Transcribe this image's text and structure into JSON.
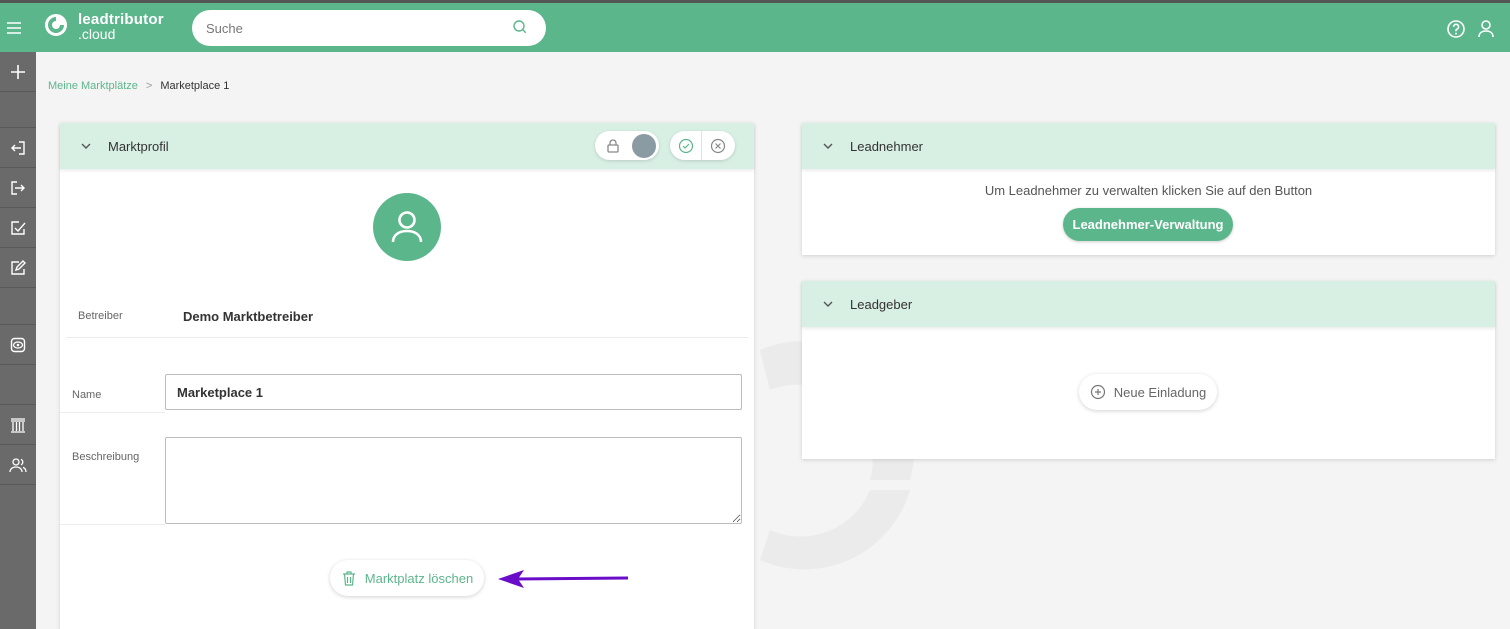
{
  "brand": {
    "name": "leadtributor",
    "suffix": ".cloud"
  },
  "search": {
    "placeholder": "Suche"
  },
  "breadcrumb": {
    "root": "Meine Marktplätze",
    "separator": ">",
    "current": "Marketplace 1"
  },
  "marktprofil": {
    "title": "Marktprofil",
    "betreiber_label": "Betreiber",
    "betreiber_value": "Demo Marktbetreiber",
    "name_label": "Name",
    "name_value": "Marketplace 1",
    "beschreibung_label": "Beschreibung",
    "beschreibung_value": "",
    "delete_label": "Marktplatz löschen"
  },
  "leadnehmer": {
    "title": "Leadnehmer",
    "hint": "Um Leadnehmer zu verwalten klicken Sie auf den Button",
    "button_label": "Leadnehmer-Verwaltung"
  },
  "leadgeber": {
    "title": "Leadgeber",
    "button_label": "Neue Einladung"
  },
  "colors": {
    "accent": "#5cb68c",
    "header_tint": "#d8efe4",
    "sidebar": "#6a6a6a",
    "annotation_arrow": "#6a0dc9"
  },
  "icons": [
    "menu-icon",
    "logo-icon",
    "search-icon",
    "help-icon",
    "user-icon",
    "plus-icon",
    "login-icon",
    "logout-icon",
    "check-doc-icon",
    "edit-icon",
    "eye-icon",
    "bank-icon",
    "users-icon",
    "chevron-down-icon",
    "lock-icon",
    "check-circle-icon",
    "close-circle-icon",
    "user-avatar-icon",
    "trash-icon",
    "plus-circle-icon"
  ]
}
